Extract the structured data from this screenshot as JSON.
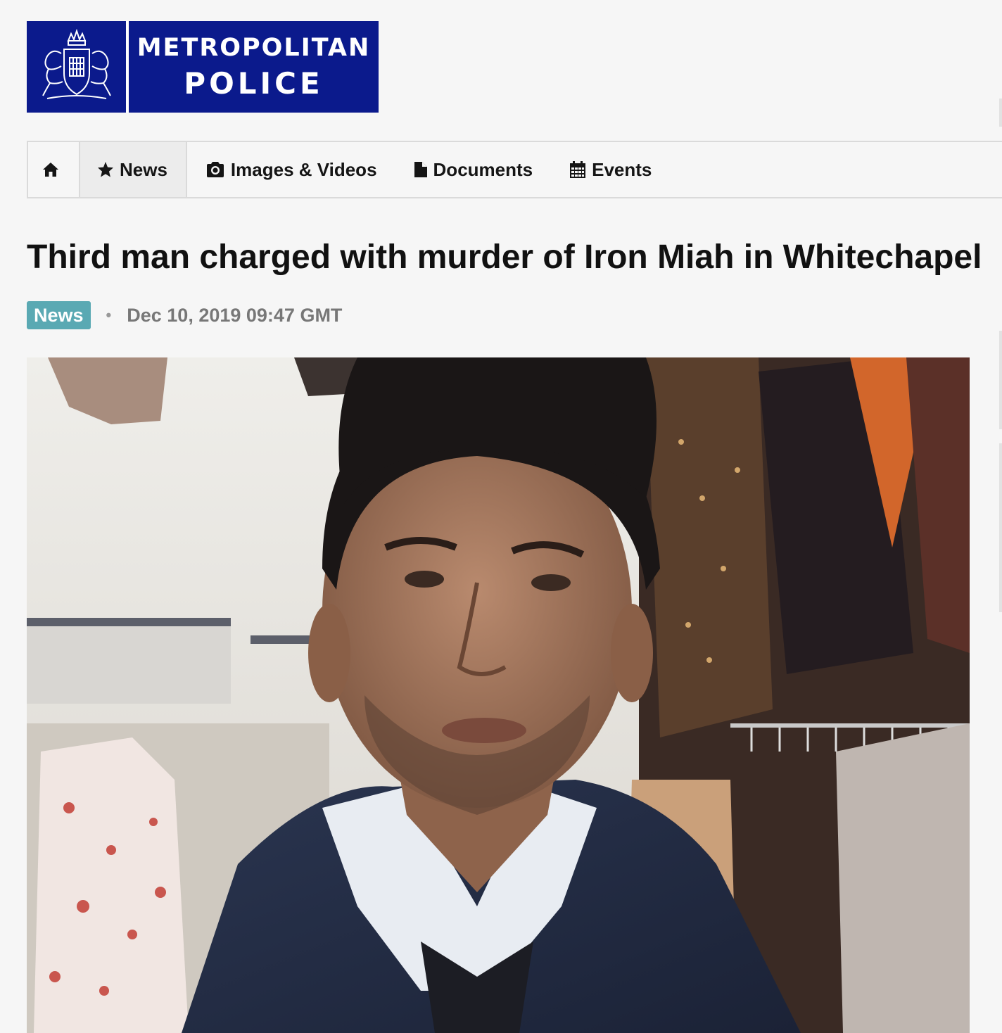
{
  "brand": {
    "line1": "METROPOLITAN",
    "line2": "POLICE",
    "crest_icon": "royal-crest-icon",
    "color": "#0b1a8c"
  },
  "nav": {
    "home_icon": "home-icon",
    "items": [
      {
        "label": "News",
        "icon": "star-icon"
      },
      {
        "label": "Images & Videos",
        "icon": "camera-icon"
      },
      {
        "label": "Documents",
        "icon": "document-icon"
      },
      {
        "label": "Events",
        "icon": "calendar-icon"
      }
    ]
  },
  "article": {
    "title": "Third man charged with murder of Iron Miah in Whitechapel",
    "category": "News",
    "separator": "•",
    "date": "Dec 10, 2019 09:47 GMT",
    "category_color": "#5aa9b3"
  }
}
